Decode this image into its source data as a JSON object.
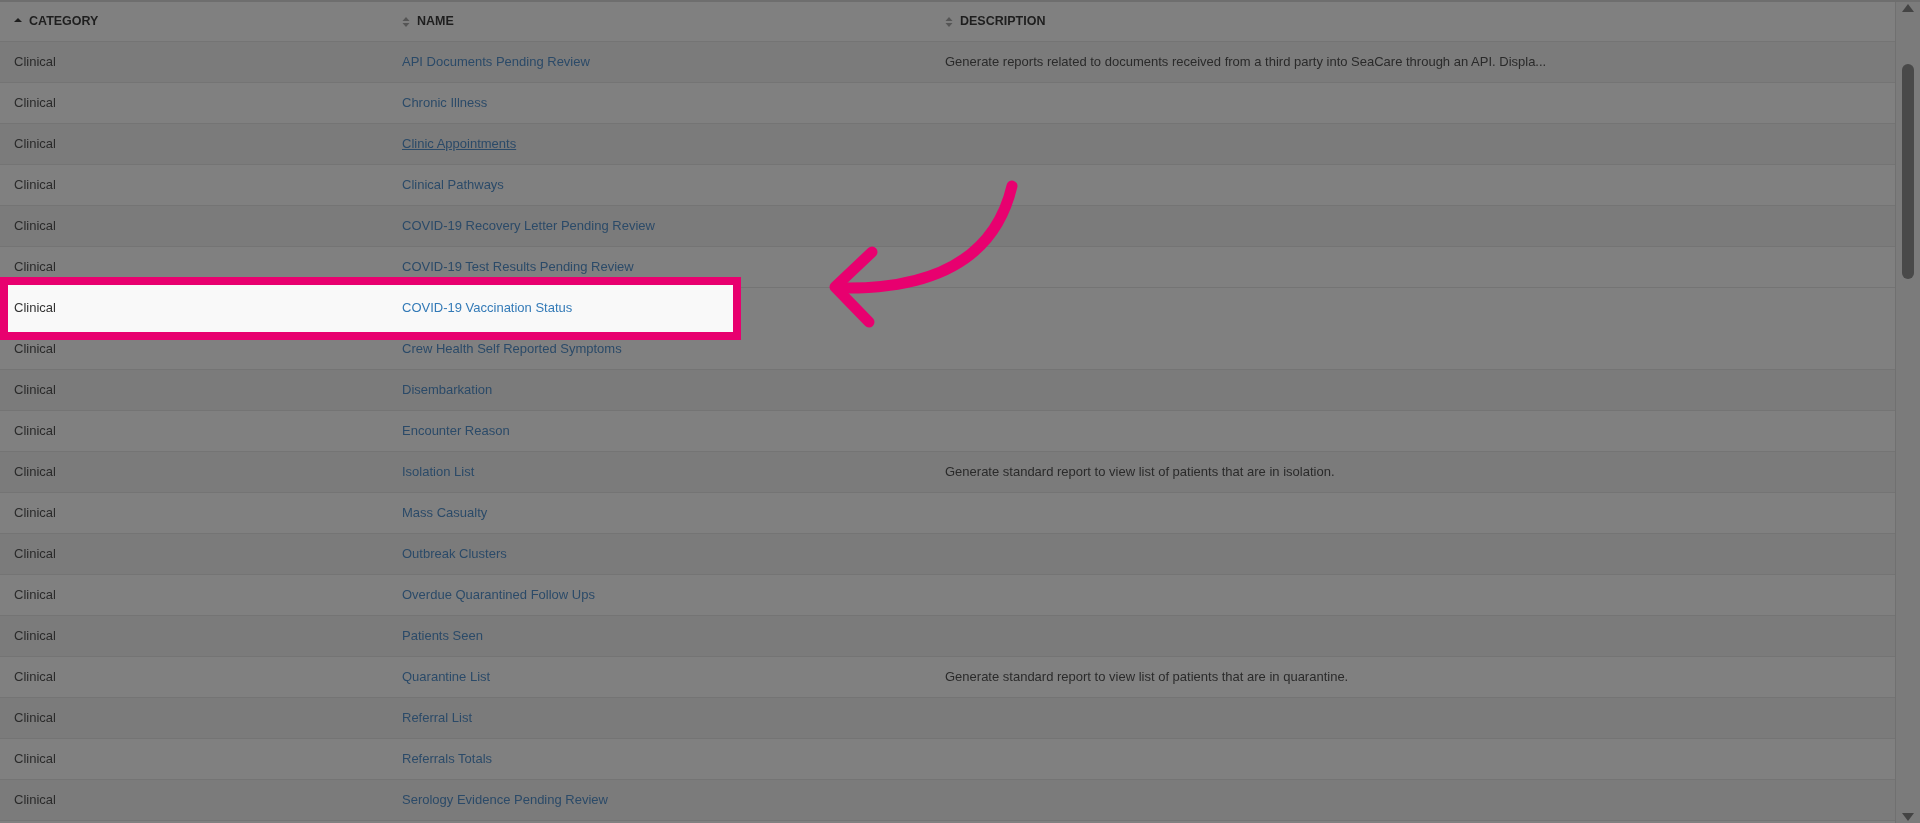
{
  "table": {
    "columns": [
      {
        "label": "CATEGORY",
        "sorted": true
      },
      {
        "label": "NAME",
        "sorted": false
      },
      {
        "label": "DESCRIPTION",
        "sorted": false
      }
    ],
    "rows": [
      {
        "category": "Clinical",
        "name": "API Documents Pending Review",
        "description": "Generate reports related to documents received from a third party into SeaCare through an API. Displa...",
        "selected": false,
        "hovered": false
      },
      {
        "category": "Clinical",
        "name": "Chronic Illness",
        "selected": false,
        "hovered": false
      },
      {
        "category": "Clinical",
        "name": "Clinic Appointments",
        "selected": false,
        "hovered": true
      },
      {
        "category": "Clinical",
        "name": "Clinical Pathways",
        "selected": false,
        "hovered": false
      },
      {
        "category": "Clinical",
        "name": "COVID-19 Recovery Letter Pending Review",
        "selected": false,
        "hovered": false
      },
      {
        "category": "Clinical",
        "name": "COVID-19 Test Results Pending Review",
        "selected": false,
        "hovered": false
      },
      {
        "category": "Clinical",
        "name": "COVID-19 Vaccination Status",
        "selected": true,
        "hovered": false
      },
      {
        "category": "Clinical",
        "name": "Crew Health Self Reported Symptoms",
        "selected": false,
        "hovered": false
      },
      {
        "category": "Clinical",
        "name": "Disembarkation",
        "selected": false,
        "hovered": false
      },
      {
        "category": "Clinical",
        "name": "Encounter Reason",
        "selected": false,
        "hovered": false
      },
      {
        "category": "Clinical",
        "name": "Isolation List",
        "description": "Generate standard report to view list of patients that are in isolation.",
        "selected": false,
        "hovered": false
      },
      {
        "category": "Clinical",
        "name": "Mass Casualty",
        "selected": false,
        "hovered": false
      },
      {
        "category": "Clinical",
        "name": "Outbreak Clusters",
        "selected": false,
        "hovered": false
      },
      {
        "category": "Clinical",
        "name": "Overdue Quarantined Follow Ups",
        "selected": false,
        "hovered": false
      },
      {
        "category": "Clinical",
        "name": "Patients Seen",
        "selected": false,
        "hovered": false
      },
      {
        "category": "Clinical",
        "name": "Quarantine List",
        "description": "Generate standard report to view list of patients that are in quarantine.",
        "selected": false,
        "hovered": false
      },
      {
        "category": "Clinical",
        "name": "Referral List",
        "selected": false,
        "hovered": false
      },
      {
        "category": "Clinical",
        "name": "Referrals Totals",
        "selected": false,
        "hovered": false
      },
      {
        "category": "Clinical",
        "name": "Serology Evidence Pending Review",
        "selected": false,
        "hovered": false
      }
    ]
  }
}
